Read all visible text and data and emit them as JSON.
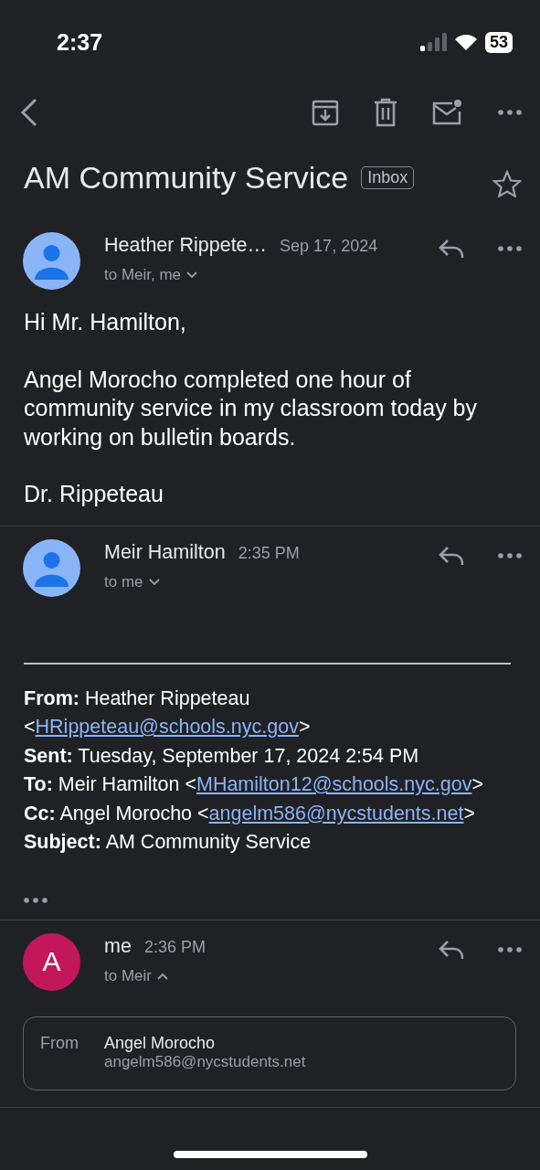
{
  "status_bar": {
    "time": "2:37",
    "battery": "53"
  },
  "subject": {
    "title": "AM Community Service",
    "label": "Inbox",
    "starred": false
  },
  "messages": [
    {
      "avatar": {
        "kind": "silhouette"
      },
      "sender": "Heather Rippete…",
      "date": "Sep 17, 2024",
      "recipients": "to Meir, me",
      "details_expanded": false,
      "body": [
        "Hi Mr. Hamilton,",
        "Angel Morocho completed one hour of community service in my classroom today by working on bulletin boards.",
        "Dr. Rippeteau"
      ]
    },
    {
      "avatar": {
        "kind": "silhouette"
      },
      "sender": "Meir Hamilton",
      "date": "2:35 PM",
      "recipients": "to me",
      "details_expanded": false,
      "quoted_header": [
        {
          "label": "From:",
          "text": "Heather Rippeteau <",
          "link": "HRippeteau@schools.nyc.gov",
          "after": ">"
        },
        {
          "label": "Sent:",
          "text": "Tuesday, September 17, 2024 2:54 PM"
        },
        {
          "label": "To:",
          "text": "Meir Hamilton <",
          "link": "MHamilton12@schools.nyc.gov",
          "after": ">"
        },
        {
          "label": "Cc:",
          "text": "Angel Morocho <",
          "link": "angelm586@nycstudents.net",
          "after": ">"
        },
        {
          "label": "Subject:",
          "text": "AM Community Service"
        }
      ],
      "trimmed": true
    },
    {
      "avatar": {
        "kind": "letter",
        "letter": "A",
        "color": "#c2185b"
      },
      "sender": "me",
      "date": "2:36 PM",
      "recipients": "to Meir",
      "details_expanded": true,
      "details": [
        {
          "label": "From",
          "name": "Angel Morocho",
          "email": "angelm586@nycstudents.net"
        }
      ]
    }
  ]
}
